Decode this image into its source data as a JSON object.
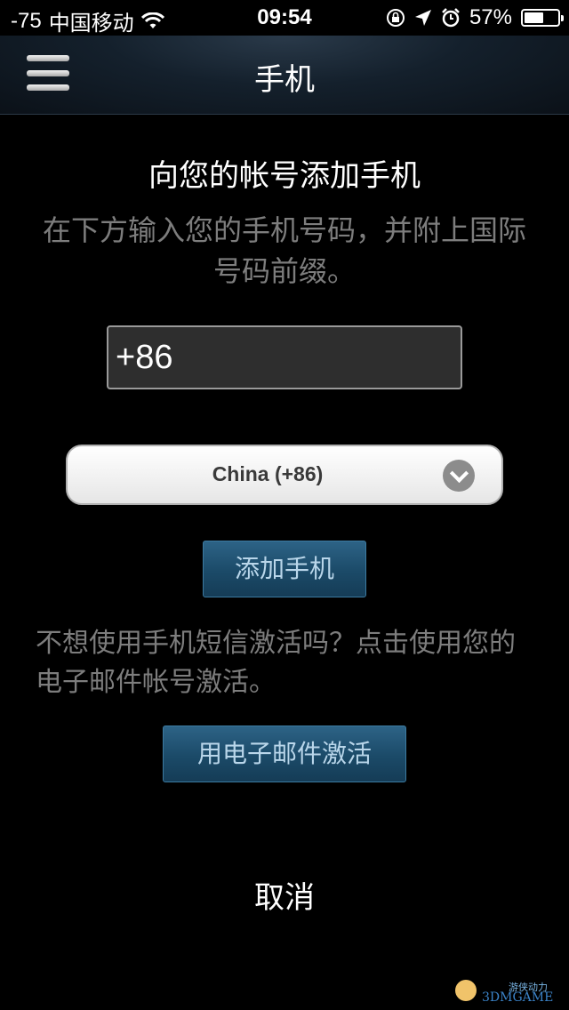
{
  "status_bar": {
    "signal": "-75",
    "carrier": "中国移动",
    "time": "09:54",
    "battery_percent": "57%",
    "battery_level": 0.57,
    "icons": [
      "wifi-icon",
      "orientation-lock-icon",
      "location-icon",
      "alarm-icon",
      "battery-icon"
    ]
  },
  "nav": {
    "title": "手机",
    "menu_icon": "hamburger-menu-icon"
  },
  "content": {
    "heading": "向您的帐号添加手机",
    "instruction": "在下方输入您的手机号码，并附上国际号码前缀。",
    "phone_input_value": "+86",
    "country_select_value": "China (+86)",
    "add_phone_label": "添加手机",
    "alt_text": "不想使用手机短信激活吗？点击使用您的电子邮件帐号激活。",
    "email_activate_label": "用电子邮件激活",
    "cancel_label": "取消"
  },
  "watermark": {
    "small_text": "游侠动力",
    "big_text": "3DMGAME"
  },
  "colors": {
    "background": "#000000",
    "nav_bar": "#14202c",
    "button_blue": "#1b4a68",
    "button_text": "#b9d6ea",
    "muted_text": "#7d7d7d"
  }
}
